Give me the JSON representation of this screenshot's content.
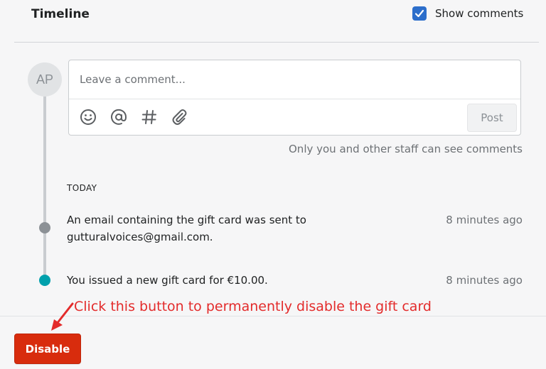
{
  "header": {
    "title": "Timeline",
    "show_comments": {
      "label": "Show comments",
      "checked": true
    }
  },
  "composer": {
    "avatar_initials": "AP",
    "placeholder": "Leave a comment...",
    "toolbar_icons": [
      "emoji-icon",
      "mention-icon",
      "hashtag-icon",
      "attachment-icon"
    ],
    "post_label": "Post",
    "privacy_note": "Only you and other staff can see comments"
  },
  "timeline": {
    "day_label": "TODAY",
    "events": [
      {
        "text": "An email containing the gift card was sent to gutturalvoices@gmail.com.",
        "time": "8 minutes ago",
        "dot_color": "#8c9196"
      },
      {
        "text": "You issued a new gift card for €10.00.",
        "time": "8 minutes ago",
        "dot_color": "#00a0ac"
      }
    ]
  },
  "annotation": {
    "text": "Click this button to permanently disable the gift card",
    "color": "#e32b2b"
  },
  "footer": {
    "disable_label": "Disable",
    "disable_color": "#d82c0d"
  }
}
